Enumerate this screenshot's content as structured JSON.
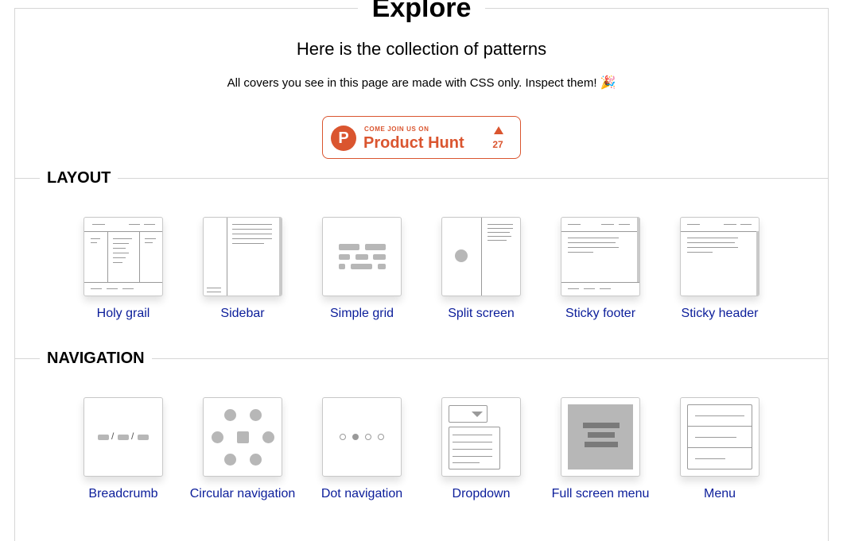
{
  "hero": {
    "title": "Explore",
    "subtitle": "Here is the collection of patterns",
    "note": "All covers you see in this page are made with CSS only. Inspect them!",
    "note_emoji": "🎉"
  },
  "product_hunt": {
    "small_text": "COME JOIN US ON",
    "big_text": "Product Hunt",
    "logo_letter": "P",
    "upvotes": "27",
    "color": "#da552f"
  },
  "sections": [
    {
      "title": "LAYOUT",
      "items": [
        {
          "label": "Holy grail",
          "icon": "holy-grail-cover"
        },
        {
          "label": "Sidebar",
          "icon": "sidebar-cover"
        },
        {
          "label": "Simple grid",
          "icon": "simple-grid-cover"
        },
        {
          "label": "Split screen",
          "icon": "split-screen-cover"
        },
        {
          "label": "Sticky footer",
          "icon": "sticky-footer-cover"
        },
        {
          "label": "Sticky header",
          "icon": "sticky-header-cover"
        }
      ]
    },
    {
      "title": "NAVIGATION",
      "items": [
        {
          "label": "Breadcrumb",
          "icon": "breadcrumb-cover"
        },
        {
          "label": "Circular navigation",
          "icon": "circular-navigation-cover"
        },
        {
          "label": "Dot navigation",
          "icon": "dot-navigation-cover"
        },
        {
          "label": "Dropdown",
          "icon": "dropdown-cover"
        },
        {
          "label": "Full screen menu",
          "icon": "full-screen-menu-cover"
        },
        {
          "label": "Menu",
          "icon": "menu-cover"
        }
      ]
    }
  ],
  "colors": {
    "link": "#0b1d9a",
    "border": "#d6d6d6",
    "cover_gray": "#b7b7b7"
  }
}
